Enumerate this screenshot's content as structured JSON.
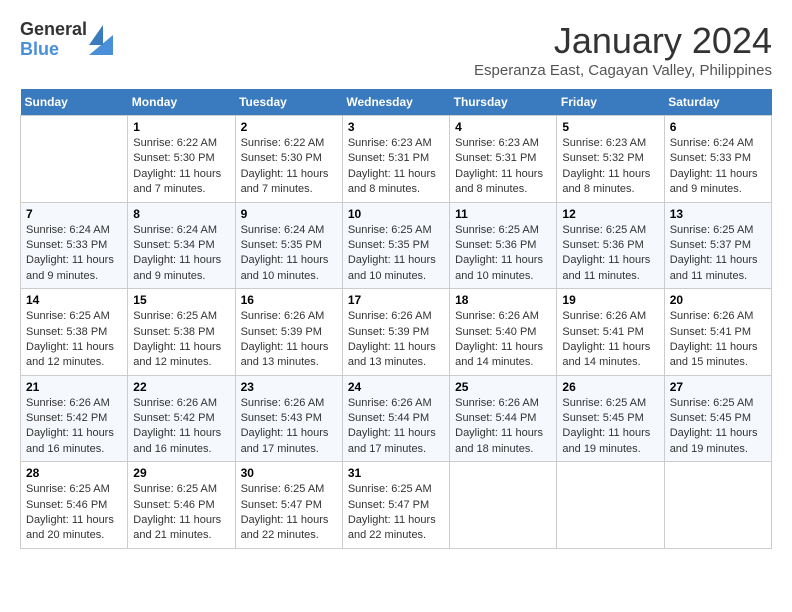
{
  "logo": {
    "general": "General",
    "blue": "Blue"
  },
  "title": "January 2024",
  "subtitle": "Esperanza East, Cagayan Valley, Philippines",
  "days_header": [
    "Sunday",
    "Monday",
    "Tuesday",
    "Wednesday",
    "Thursday",
    "Friday",
    "Saturday"
  ],
  "weeks": [
    [
      {
        "num": "",
        "info": ""
      },
      {
        "num": "1",
        "info": "Sunrise: 6:22 AM\nSunset: 5:30 PM\nDaylight: 11 hours\nand 7 minutes."
      },
      {
        "num": "2",
        "info": "Sunrise: 6:22 AM\nSunset: 5:30 PM\nDaylight: 11 hours\nand 7 minutes."
      },
      {
        "num": "3",
        "info": "Sunrise: 6:23 AM\nSunset: 5:31 PM\nDaylight: 11 hours\nand 8 minutes."
      },
      {
        "num": "4",
        "info": "Sunrise: 6:23 AM\nSunset: 5:31 PM\nDaylight: 11 hours\nand 8 minutes."
      },
      {
        "num": "5",
        "info": "Sunrise: 6:23 AM\nSunset: 5:32 PM\nDaylight: 11 hours\nand 8 minutes."
      },
      {
        "num": "6",
        "info": "Sunrise: 6:24 AM\nSunset: 5:33 PM\nDaylight: 11 hours\nand 9 minutes."
      }
    ],
    [
      {
        "num": "7",
        "info": "Sunrise: 6:24 AM\nSunset: 5:33 PM\nDaylight: 11 hours\nand 9 minutes."
      },
      {
        "num": "8",
        "info": "Sunrise: 6:24 AM\nSunset: 5:34 PM\nDaylight: 11 hours\nand 9 minutes."
      },
      {
        "num": "9",
        "info": "Sunrise: 6:24 AM\nSunset: 5:35 PM\nDaylight: 11 hours\nand 10 minutes."
      },
      {
        "num": "10",
        "info": "Sunrise: 6:25 AM\nSunset: 5:35 PM\nDaylight: 11 hours\nand 10 minutes."
      },
      {
        "num": "11",
        "info": "Sunrise: 6:25 AM\nSunset: 5:36 PM\nDaylight: 11 hours\nand 10 minutes."
      },
      {
        "num": "12",
        "info": "Sunrise: 6:25 AM\nSunset: 5:36 PM\nDaylight: 11 hours\nand 11 minutes."
      },
      {
        "num": "13",
        "info": "Sunrise: 6:25 AM\nSunset: 5:37 PM\nDaylight: 11 hours\nand 11 minutes."
      }
    ],
    [
      {
        "num": "14",
        "info": "Sunrise: 6:25 AM\nSunset: 5:38 PM\nDaylight: 11 hours\nand 12 minutes."
      },
      {
        "num": "15",
        "info": "Sunrise: 6:25 AM\nSunset: 5:38 PM\nDaylight: 11 hours\nand 12 minutes."
      },
      {
        "num": "16",
        "info": "Sunrise: 6:26 AM\nSunset: 5:39 PM\nDaylight: 11 hours\nand 13 minutes."
      },
      {
        "num": "17",
        "info": "Sunrise: 6:26 AM\nSunset: 5:39 PM\nDaylight: 11 hours\nand 13 minutes."
      },
      {
        "num": "18",
        "info": "Sunrise: 6:26 AM\nSunset: 5:40 PM\nDaylight: 11 hours\nand 14 minutes."
      },
      {
        "num": "19",
        "info": "Sunrise: 6:26 AM\nSunset: 5:41 PM\nDaylight: 11 hours\nand 14 minutes."
      },
      {
        "num": "20",
        "info": "Sunrise: 6:26 AM\nSunset: 5:41 PM\nDaylight: 11 hours\nand 15 minutes."
      }
    ],
    [
      {
        "num": "21",
        "info": "Sunrise: 6:26 AM\nSunset: 5:42 PM\nDaylight: 11 hours\nand 16 minutes."
      },
      {
        "num": "22",
        "info": "Sunrise: 6:26 AM\nSunset: 5:42 PM\nDaylight: 11 hours\nand 16 minutes."
      },
      {
        "num": "23",
        "info": "Sunrise: 6:26 AM\nSunset: 5:43 PM\nDaylight: 11 hours\nand 17 minutes."
      },
      {
        "num": "24",
        "info": "Sunrise: 6:26 AM\nSunset: 5:44 PM\nDaylight: 11 hours\nand 17 minutes."
      },
      {
        "num": "25",
        "info": "Sunrise: 6:26 AM\nSunset: 5:44 PM\nDaylight: 11 hours\nand 18 minutes."
      },
      {
        "num": "26",
        "info": "Sunrise: 6:25 AM\nSunset: 5:45 PM\nDaylight: 11 hours\nand 19 minutes."
      },
      {
        "num": "27",
        "info": "Sunrise: 6:25 AM\nSunset: 5:45 PM\nDaylight: 11 hours\nand 19 minutes."
      }
    ],
    [
      {
        "num": "28",
        "info": "Sunrise: 6:25 AM\nSunset: 5:46 PM\nDaylight: 11 hours\nand 20 minutes."
      },
      {
        "num": "29",
        "info": "Sunrise: 6:25 AM\nSunset: 5:46 PM\nDaylight: 11 hours\nand 21 minutes."
      },
      {
        "num": "30",
        "info": "Sunrise: 6:25 AM\nSunset: 5:47 PM\nDaylight: 11 hours\nand 22 minutes."
      },
      {
        "num": "31",
        "info": "Sunrise: 6:25 AM\nSunset: 5:47 PM\nDaylight: 11 hours\nand 22 minutes."
      },
      {
        "num": "",
        "info": ""
      },
      {
        "num": "",
        "info": ""
      },
      {
        "num": "",
        "info": ""
      }
    ]
  ]
}
